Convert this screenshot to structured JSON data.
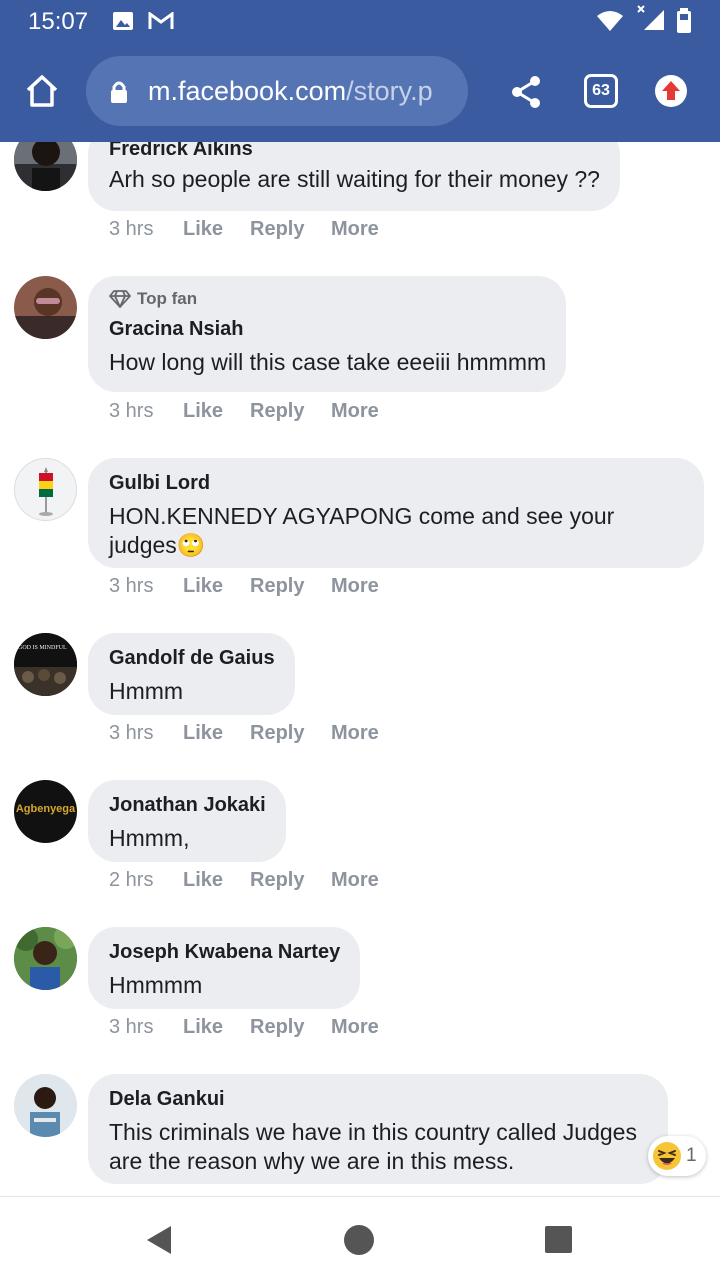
{
  "status_bar": {
    "time": "15:07",
    "icons": [
      "image-icon",
      "gmail-icon",
      "wifi-icon",
      "signal-icon",
      "battery-icon"
    ]
  },
  "browser": {
    "url_host": "m.facebook.com",
    "url_path": "/story.p",
    "tab_count": "63",
    "colors": {
      "toolbar": "#3b5ba0",
      "urlbar": "#5574b4",
      "update": "#e53935"
    }
  },
  "comments": [
    {
      "name": "Fredrick Aikins",
      "text": "Arh so people are still waiting for their money ??",
      "time": "3 hrs",
      "like": "Like",
      "reply": "Reply",
      "more": "More"
    },
    {
      "badge": "Top fan",
      "name": "Gracina Nsiah",
      "text": "How long will this case take eeeiii hmmmm",
      "time": "3 hrs",
      "like": "Like",
      "reply": "Reply",
      "more": "More"
    },
    {
      "name": "Gulbi Lord",
      "text": "HON.KENNEDY AGYAPONG come and see your judges",
      "emoji": "🙄",
      "time": "3 hrs",
      "like": "Like",
      "reply": "Reply",
      "more": "More"
    },
    {
      "name": "Gandolf de Gaius",
      "text": "Hmmm",
      "avatar_text": "GOD IS MINDFUL",
      "time": "3 hrs",
      "like": "Like",
      "reply": "Reply",
      "more": "More"
    },
    {
      "name": "Jonathan Jokaki",
      "text": "Hmmm,",
      "avatar_text": "Agbenyega",
      "time": "2 hrs",
      "like": "Like",
      "reply": "Reply",
      "more": "More"
    },
    {
      "name": "Joseph Kwabena Nartey",
      "text": "Hmmmm",
      "time": "3 hrs",
      "like": "Like",
      "reply": "Reply",
      "more": "More"
    },
    {
      "name": "Dela Gankui",
      "text": "This criminals we have in this country called Judges are the reason why we are in this mess.",
      "reaction_count": "1"
    }
  ]
}
